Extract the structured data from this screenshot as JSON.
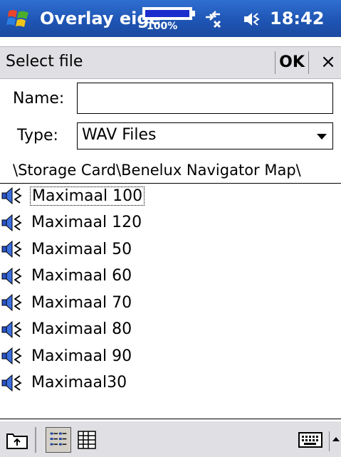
{
  "window": {
    "app_title": "Overlay eige",
    "battery_percent": "100%",
    "battery_level": 1.0,
    "time": "18:42"
  },
  "dialog": {
    "title": "Select file",
    "ok_label": "OK",
    "close_label": "×"
  },
  "form": {
    "name_label": "Name:",
    "name_value": "",
    "type_label": "Type:",
    "type_value": "WAV Files"
  },
  "path": "\\Storage Card\\Benelux Navigator Map\\",
  "files": [
    {
      "name": "Maximaal 100",
      "icon": "wav-sound-icon"
    },
    {
      "name": "Maximaal 120",
      "icon": "wav-sound-icon"
    },
    {
      "name": "Maximaal 50",
      "icon": "wav-sound-icon"
    },
    {
      "name": "Maximaal 60",
      "icon": "wav-sound-icon"
    },
    {
      "name": "Maximaal 70",
      "icon": "wav-sound-icon"
    },
    {
      "name": "Maximaal 80",
      "icon": "wav-sound-icon"
    },
    {
      "name": "Maximaal 90",
      "icon": "wav-sound-icon"
    },
    {
      "name": "Maximaal30",
      "icon": "wav-sound-icon"
    }
  ],
  "selected_index": 0,
  "toolbar": {
    "icons": [
      "up-folder-icon",
      "list-view-icon",
      "details-view-icon",
      "keyboard-icon",
      "input-menu-arrow-icon"
    ]
  },
  "colors": {
    "titlebar": "#1f55b4",
    "battery_fill": "#1a2ccc",
    "bars": "#e0dfe3"
  }
}
